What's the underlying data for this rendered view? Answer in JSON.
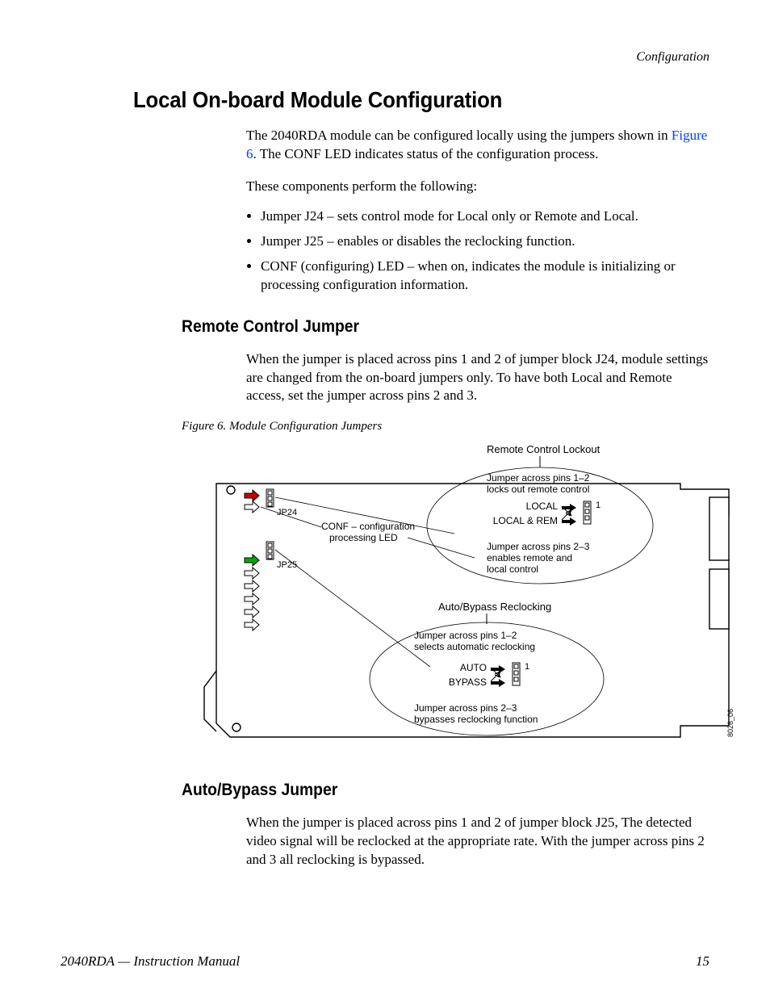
{
  "running_head": "Configuration",
  "h1": "Local On-board Module Configuration",
  "intro_pre": "The 2040RDA module can be configured locally using the jumpers shown in ",
  "intro_link": "Figure 6",
  "intro_post": ". The CONF LED indicates status of the configuration process.",
  "intro2": "These components perform the following:",
  "bullets": {
    "b1": "Jumper J24 – sets control mode for Local only or Remote and Local.",
    "b2": "Jumper J25 – enables or disables the reclocking function.",
    "b3": "CONF (configuring) LED – when on, indicates the module is initializing or processing configuration information."
  },
  "h2a": "Remote Control Jumper",
  "para_a": "When the jumper is placed across pins 1 and 2 of jumper block J24, module settings are changed from the on-board jumpers only. To have both Local and Remote access, set the jumper across pins 2 and 3.",
  "fig_caption": "Figure 6.  Module Configuration Jumpers",
  "fig": {
    "title1": "Remote Control Lockout",
    "call1a": "Jumper across pins 1–2",
    "call1b": "locks out remote control",
    "label_local": "LOCAL",
    "label_localrem": "LOCAL & REM",
    "pin1a": "1",
    "call1c": "Jumper across pins 2–3",
    "call1d": "enables remote and",
    "call1e": "local control",
    "conf1": "CONF – configuration",
    "conf2": "processing  LED",
    "jp24": "JP24",
    "jp25": "JP25",
    "title2": "Auto/Bypass Reclocking",
    "call2a": "Jumper across pins 1–2",
    "call2b": "selects automatic reclocking",
    "label_auto": "AUTO",
    "label_bypass": "BYPASS",
    "pin1b": "1",
    "call2c": "Jumper across pins 2–3",
    "call2d": "bypasses reclocking function",
    "drawing_no": "8026_06"
  },
  "h2b": "Auto/Bypass Jumper",
  "para_b": "When the jumper is placed across pins 1 and 2 of jumper block J25, The detected video signal will be reclocked at the appropriate rate. With the jumper across pins 2 and 3 all reclocking is bypassed.",
  "footer_left": "2040RDA — Instruction Manual",
  "footer_right": "15"
}
